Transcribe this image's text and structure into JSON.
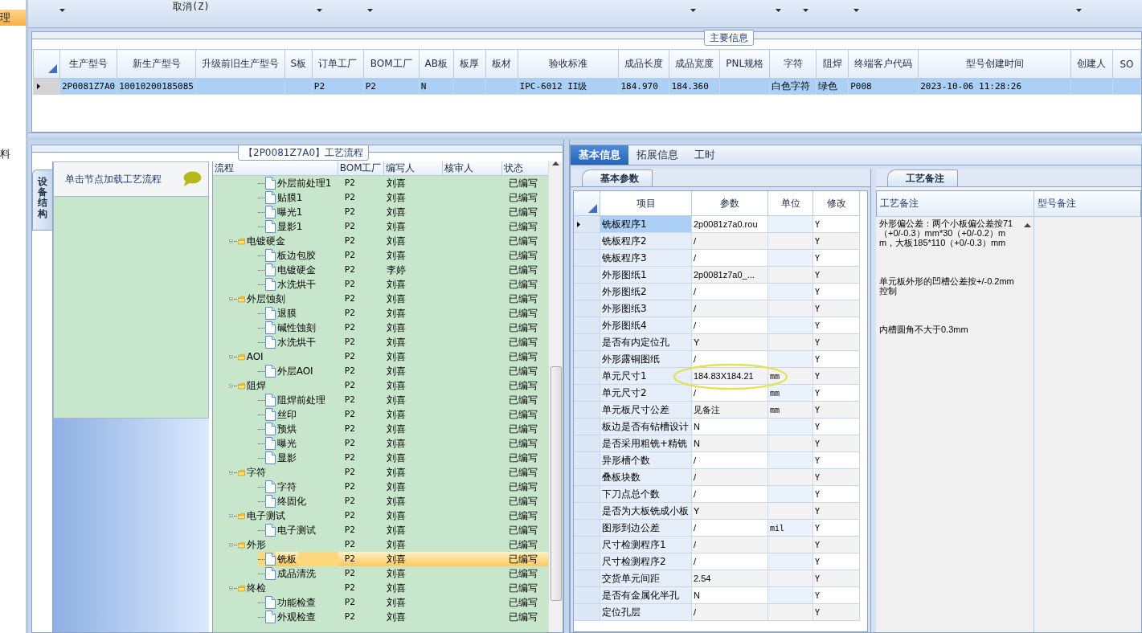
{
  "sidebar": {
    "items": [
      {
        "label": "理",
        "selected": true
      },
      {
        "label": "料",
        "selected": false
      }
    ]
  },
  "toolbar": {
    "cancel_label": "取消(Z)"
  },
  "main_info": {
    "title": "主要信息",
    "columns": [
      "生产型号",
      "新生产型号",
      "升级前旧生产型号",
      "S板",
      "订单工厂",
      "BOM工厂",
      "AB板",
      "板厚",
      "板材",
      "验收标准",
      "成品长度",
      "成品宽度",
      "PNL规格",
      "字符",
      "阻焊",
      "终端客户代码",
      "型号创建时间",
      "创建人",
      "SO"
    ],
    "rows": [
      {
        "selected": true,
        "cells": [
          "2P0081Z7A0",
          "10010200185085",
          "",
          "",
          "P2",
          "P2",
          "N",
          "",
          "",
          "IPC-6012 II级",
          "184.970",
          "184.360",
          "",
          "白色字符",
          "绿色",
          "P008",
          "2023-10-06 11:28:26",
          "",
          ""
        ]
      }
    ]
  },
  "process_flow": {
    "title": "【2P0081Z7A0】工艺流程",
    "side_tab": "设备结构",
    "hint": "单击节点加载工艺流程",
    "columns": [
      "流程",
      "BOM工厂",
      "编写人",
      "核审人",
      "状态"
    ],
    "tree": [
      {
        "kind": "continued",
        "children": [
          {
            "kind": "step",
            "label": "外层前处理1",
            "bom": "P2",
            "writer": "刘喜",
            "status": "已编写",
            "selected": false
          },
          {
            "kind": "step",
            "label": "贴膜1",
            "bom": "P2",
            "writer": "刘喜",
            "status": "已编写",
            "selected": false
          },
          {
            "kind": "step",
            "label": "曝光1",
            "bom": "P2",
            "writer": "刘喜",
            "status": "已编写",
            "selected": false
          },
          {
            "kind": "step",
            "label": "显影1",
            "bom": "P2",
            "writer": "刘喜",
            "status": "已编写",
            "selected": false
          }
        ]
      },
      {
        "kind": "folder",
        "label": "电镀硬金",
        "bom": "P2",
        "writer": "刘喜",
        "status": "已编写",
        "selected": false,
        "children": [
          {
            "kind": "step",
            "label": "板边包胶",
            "bom": "P2",
            "writer": "刘喜",
            "status": "已编写",
            "selected": false
          },
          {
            "kind": "step",
            "label": "电镀硬金",
            "bom": "P2",
            "writer": "李婷",
            "status": "已编写",
            "selected": false
          },
          {
            "kind": "step",
            "label": "水洗烘干",
            "bom": "P2",
            "writer": "刘喜",
            "status": "已编写",
            "selected": false
          }
        ]
      },
      {
        "kind": "folder",
        "label": "外层蚀刻",
        "bom": "P2",
        "writer": "刘喜",
        "status": "已编写",
        "selected": false,
        "children": [
          {
            "kind": "step",
            "label": "退膜",
            "bom": "P2",
            "writer": "刘喜",
            "status": "已编写",
            "selected": false
          },
          {
            "kind": "step",
            "label": "碱性蚀刻",
            "bom": "P2",
            "writer": "刘喜",
            "status": "已编写",
            "selected": false
          },
          {
            "kind": "step",
            "label": "水洗烘干",
            "bom": "P2",
            "writer": "刘喜",
            "status": "已编写",
            "selected": false
          }
        ]
      },
      {
        "kind": "folder",
        "label": "AOI",
        "bom": "P2",
        "writer": "刘喜",
        "status": "已编写",
        "selected": false,
        "children": [
          {
            "kind": "step",
            "label": "外层AOI",
            "bom": "P2",
            "writer": "刘喜",
            "status": "已编写",
            "selected": false
          }
        ]
      },
      {
        "kind": "folder",
        "label": "阻焊",
        "bom": "P2",
        "writer": "刘喜",
        "status": "已编写",
        "selected": false,
        "children": [
          {
            "kind": "step",
            "label": "阻焊前处理",
            "bom": "P2",
            "writer": "刘喜",
            "status": "已编写",
            "selected": false
          },
          {
            "kind": "step",
            "label": "丝印",
            "bom": "P2",
            "writer": "刘喜",
            "status": "已编写",
            "selected": false
          },
          {
            "kind": "step",
            "label": "预烘",
            "bom": "P2",
            "writer": "刘喜",
            "status": "已编写",
            "selected": false
          },
          {
            "kind": "step",
            "label": "曝光",
            "bom": "P2",
            "writer": "刘喜",
            "status": "已编写",
            "selected": false
          },
          {
            "kind": "step",
            "label": "显影",
            "bom": "P2",
            "writer": "刘喜",
            "status": "已编写",
            "selected": false
          }
        ]
      },
      {
        "kind": "folder",
        "label": "字符",
        "bom": "P2",
        "writer": "刘喜",
        "status": "已编写",
        "selected": false,
        "children": [
          {
            "kind": "step",
            "label": "字符",
            "bom": "P2",
            "writer": "刘喜",
            "status": "已编写",
            "selected": false
          },
          {
            "kind": "step",
            "label": "终固化",
            "bom": "P2",
            "writer": "刘喜",
            "status": "已编写",
            "selected": false
          }
        ]
      },
      {
        "kind": "folder",
        "label": "电子测试",
        "bom": "P2",
        "writer": "刘喜",
        "status": "已编写",
        "selected": false,
        "children": [
          {
            "kind": "step",
            "label": "电子测试",
            "bom": "P2",
            "writer": "刘喜",
            "status": "已编写",
            "selected": false
          }
        ]
      },
      {
        "kind": "folder",
        "label": "外形",
        "bom": "P2",
        "writer": "刘喜",
        "status": "已编写",
        "selected": false,
        "children": [
          {
            "kind": "step",
            "label": "铣板",
            "bom": "P2",
            "writer": "刘喜",
            "status": "已编写",
            "selected": true
          },
          {
            "kind": "step",
            "label": "成品清洗",
            "bom": "P2",
            "writer": "刘喜",
            "status": "已编写",
            "selected": false
          }
        ]
      },
      {
        "kind": "folder",
        "label": "终检",
        "bom": "P2",
        "writer": "刘喜",
        "status": "已编写",
        "selected": false,
        "children": [
          {
            "kind": "step",
            "label": "功能检查",
            "bom": "P2",
            "writer": "刘喜",
            "status": "已编写",
            "selected": false
          },
          {
            "kind": "step",
            "label": "外观检查",
            "bom": "P2",
            "writer": "刘喜",
            "status": "已编写",
            "selected": false
          }
        ]
      }
    ]
  },
  "detail": {
    "tabs": [
      {
        "label": "基本信息",
        "selected": true
      },
      {
        "label": "拓展信息",
        "selected": false
      },
      {
        "label": "工时",
        "selected": false
      }
    ],
    "params_tab": "基本参数",
    "columns": [
      "项目",
      "参数",
      "单位",
      "修改"
    ],
    "rows": [
      {
        "item": "铣板程序1",
        "value": "2p0081z7a0.rou",
        "unit": "",
        "edit": "Y",
        "selected": true
      },
      {
        "item": "铣板程序2",
        "value": "/",
        "unit": "",
        "edit": "Y",
        "selected": false
      },
      {
        "item": "铣板程序3",
        "value": "/",
        "unit": "",
        "edit": "Y",
        "selected": false
      },
      {
        "item": "外形图纸1",
        "value": "2p0081z7a0_...",
        "unit": "",
        "edit": "Y",
        "selected": false
      },
      {
        "item": "外形图纸2",
        "value": "/",
        "unit": "",
        "edit": "Y",
        "selected": false
      },
      {
        "item": "外形图纸3",
        "value": "/",
        "unit": "",
        "edit": "Y",
        "selected": false
      },
      {
        "item": "外形图纸4",
        "value": "/",
        "unit": "",
        "edit": "Y",
        "selected": false
      },
      {
        "item": "是否有内定位孔",
        "value": "Y",
        "unit": "",
        "edit": "Y",
        "selected": false
      },
      {
        "item": "外形露铜图纸",
        "value": "/",
        "unit": "",
        "edit": "Y",
        "selected": false
      },
      {
        "item": "单元尺寸1",
        "value": "184.83X184.21",
        "unit": "mm",
        "edit": "Y",
        "selected": false
      },
      {
        "item": "单元尺寸2",
        "value": "/",
        "unit": "mm",
        "edit": "Y",
        "selected": false
      },
      {
        "item": "单元板尺寸公差",
        "value": "见备注",
        "unit": "mm",
        "edit": "Y",
        "selected": false
      },
      {
        "item": "板边是否有钻槽设计",
        "value": "N",
        "unit": "",
        "edit": "Y",
        "selected": false
      },
      {
        "item": "是否采用粗铣+精铣",
        "value": "N",
        "unit": "",
        "edit": "Y",
        "selected": false
      },
      {
        "item": "异形槽个数",
        "value": "/",
        "unit": "",
        "edit": "Y",
        "selected": false
      },
      {
        "item": "叠板块数",
        "value": "/",
        "unit": "",
        "edit": "Y",
        "selected": false
      },
      {
        "item": "下刀点总个数",
        "value": "/",
        "unit": "",
        "edit": "Y",
        "selected": false
      },
      {
        "item": "是否为大板铣成小板",
        "value": "Y",
        "unit": "",
        "edit": "Y",
        "selected": false
      },
      {
        "item": "图形到边公差",
        "value": "/",
        "unit": "mil",
        "edit": "Y",
        "selected": false
      },
      {
        "item": "尺寸检测程序1",
        "value": "/",
        "unit": "",
        "edit": "Y",
        "selected": false
      },
      {
        "item": "尺寸检测程序2",
        "value": "/",
        "unit": "",
        "edit": "Y",
        "selected": false
      },
      {
        "item": "交货单元间距",
        "value": "2.54",
        "unit": "",
        "edit": "Y",
        "selected": false
      },
      {
        "item": "是否有金属化半孔",
        "value": "N",
        "unit": "",
        "edit": "Y",
        "selected": false
      },
      {
        "item": "定位孔层",
        "value": "/",
        "unit": "",
        "edit": "Y",
        "selected": false
      }
    ],
    "notes": {
      "tab": "工艺备注",
      "columns": [
        "工艺备注",
        "型号备注"
      ],
      "process_note": [
        "外形偏公差：两个小板偏公差按71（+0/-0.3）mm*30（+0/-0.2）mm，大板185*110（+0/-0.3）mm",
        "单元板外形的凹槽公差按+/-0.2mm控制",
        "内槽圆角不大于0.3mm"
      ]
    }
  }
}
